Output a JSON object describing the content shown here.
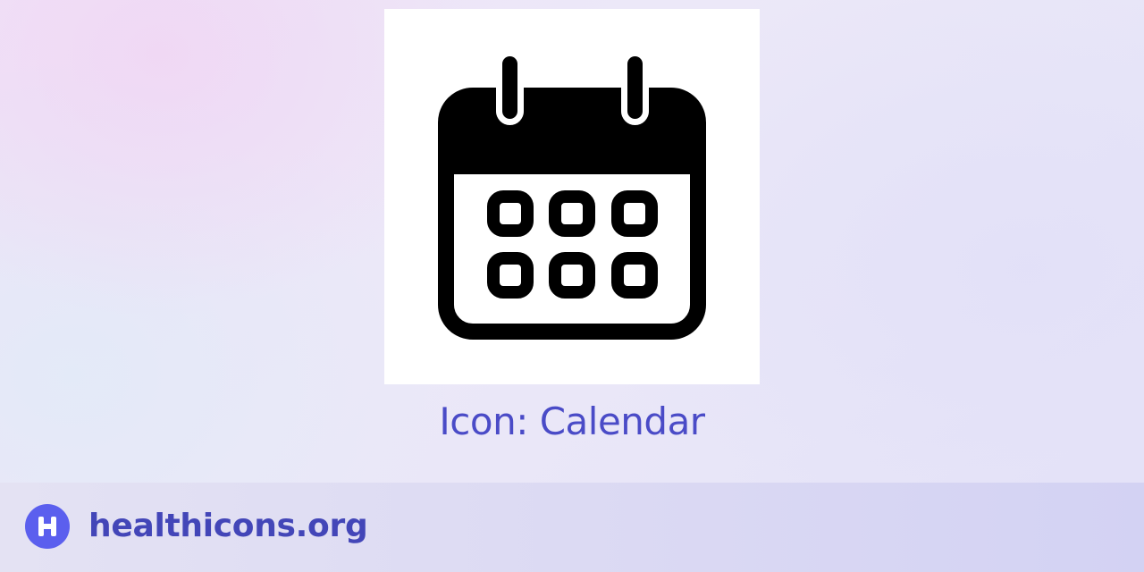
{
  "icon": {
    "name": "calendar-icon",
    "title": "Icon: Calendar"
  },
  "footer": {
    "logo_icon": "healthicons-logo-icon",
    "logo_letter": "H",
    "site_name": "healthicons.org"
  },
  "colors": {
    "title": "#4a4bc7",
    "logo_background": "#5b5fee",
    "site_name": "#4346b8",
    "icon_glyph": "#000000",
    "card_background": "#ffffff"
  }
}
